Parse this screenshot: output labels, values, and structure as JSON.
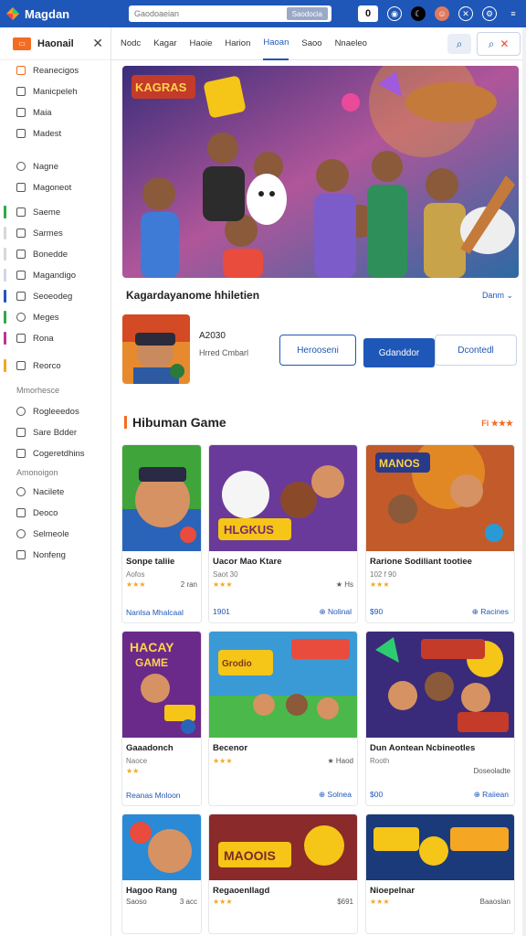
{
  "topbar": {
    "brand": "Magdan",
    "search_placeholder": "Gaodoaeian",
    "search_button": "Saodocia",
    "box_label": "0"
  },
  "sidebar": {
    "title": "Haonail",
    "items": [
      {
        "label": "Reanecigos"
      },
      {
        "label": "Manicpeleh"
      },
      {
        "label": "Maia"
      },
      {
        "label": "Madest"
      },
      {
        "label": "Nagne"
      },
      {
        "label": "Magoneot"
      },
      {
        "label": "Saeme"
      },
      {
        "label": "Sarmes"
      },
      {
        "label": "Bonedde"
      },
      {
        "label": "Magandigo"
      },
      {
        "label": "Seoeodeg"
      },
      {
        "label": "Meges"
      },
      {
        "label": "Rona"
      },
      {
        "label": "Reorco"
      },
      {
        "label": "Rogleeedos"
      },
      {
        "label": "Sare Bdder"
      },
      {
        "label": "Cogeretdhins"
      },
      {
        "label": "Nacilete"
      },
      {
        "label": "Deoco"
      },
      {
        "label": "Selmeole"
      },
      {
        "label": "Nonfeng"
      }
    ],
    "section_a": "Mmorhesce",
    "section_b": "Amonoigon"
  },
  "tabs": [
    "Nodc",
    "Kagar",
    "Haoie",
    "Harion",
    "Haoan",
    "Saoo",
    "Nnaeleo"
  ],
  "hero": {
    "title": "Kagardayanome hhiletien",
    "link": "Danm ⌄"
  },
  "featured": {
    "code": "A2030",
    "sub": "Hrred Cmbarl",
    "btn_ghost_1": "Herooseni",
    "btn_solid": "Gdanddor",
    "btn_ghost_2": "Dcontedl"
  },
  "section": {
    "title": "Hibuman Game",
    "more": "Fi ★★★"
  },
  "cards": [
    {
      "title": "Sonpe taliie",
      "sub": "Aofos",
      "stars": "★★★",
      "num": "2 ran",
      "b1": "Nanlsa Mhalcaal",
      "b2": ""
    },
    {
      "title": "Uacor Mao Ktare",
      "sub": "Saot 30",
      "stars": "★★★",
      "num": "★ Hs",
      "b1": "1901",
      "b2": "⊕ Nolinal"
    },
    {
      "title": "Rarione Sodiliant tootiee",
      "sub": "102 f 90",
      "stars": "★★★",
      "num": "",
      "b1": "$90",
      "b2": "⊕ Racines"
    },
    {
      "title": "Gaaadonch",
      "sub": "Naoce",
      "stars": "★★",
      "num": "",
      "b1": "Reanas Mnloon",
      "b2": ""
    },
    {
      "title": "Becenor",
      "sub": "",
      "stars": "★★★",
      "num": "★ Haod",
      "b1": "",
      "b2": "⊕ Solnea"
    },
    {
      "title": "Dun Aontean Ncbineotles",
      "sub": "Rooth",
      "stars": "",
      "num": "Doseoladte",
      "b1": "$00",
      "b2": "⊕ Raiiean"
    },
    {
      "title": "Hagoo Rang",
      "sub": "Saoso",
      "stars": "",
      "num": "3 acc",
      "b1": "",
      "b2": ""
    },
    {
      "title": "Regaoenllagd",
      "sub": "",
      "stars": "★★★",
      "num": "$691",
      "b1": "",
      "b2": ""
    },
    {
      "title": "Nioepelnar",
      "sub": "",
      "stars": "★★★",
      "num": "Baaoslan",
      "b1": "",
      "b2": ""
    }
  ],
  "colors": {
    "primary": "#1f57b8",
    "accent": "#f26c22",
    "star": "#f5a623"
  }
}
